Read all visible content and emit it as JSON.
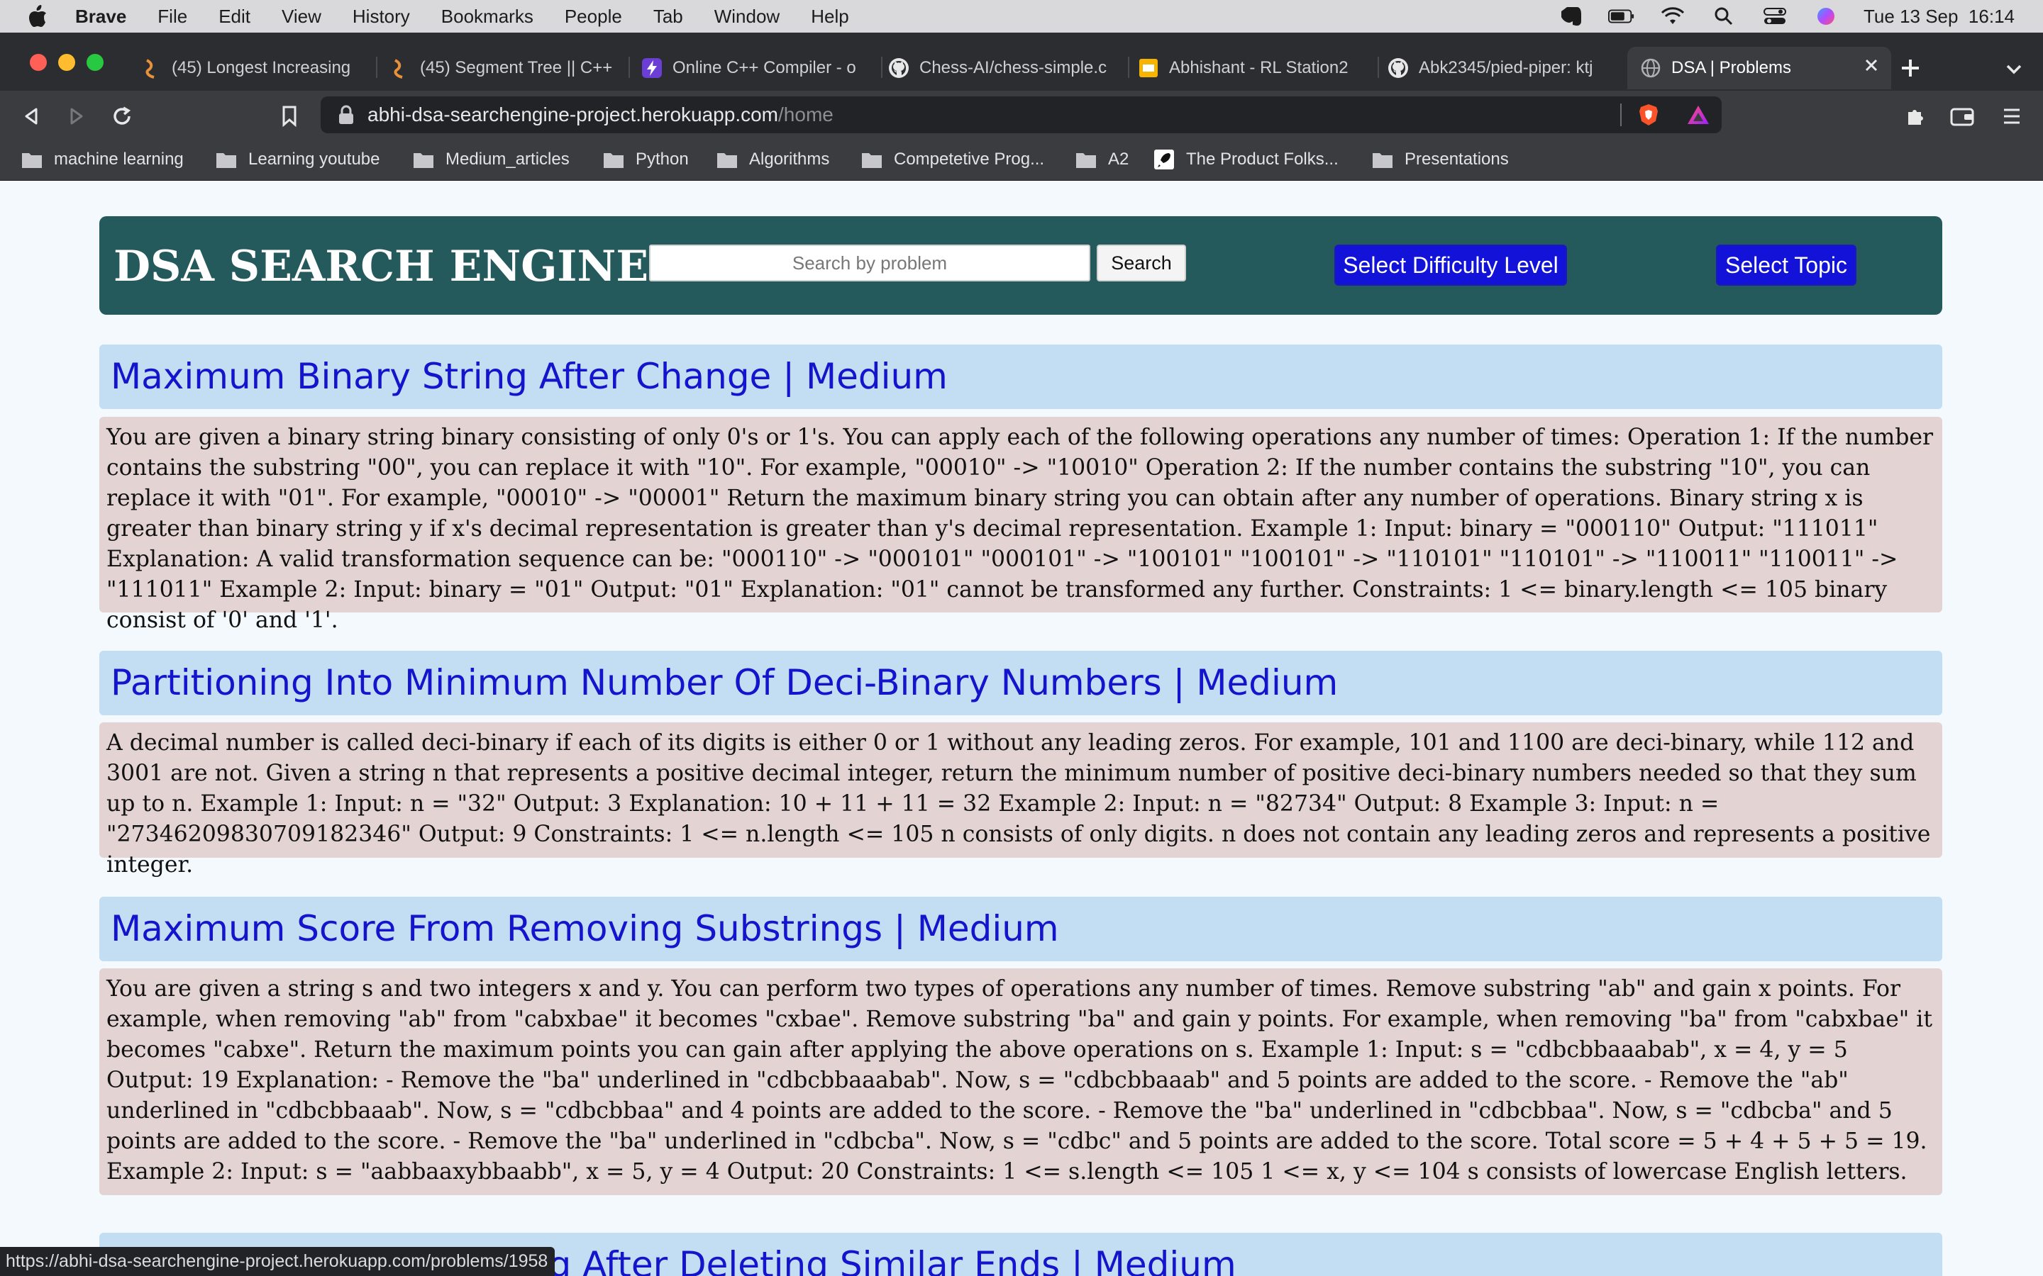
{
  "menubar": {
    "app_name": "Brave",
    "items": [
      "File",
      "Edit",
      "View",
      "History",
      "Bookmarks",
      "People",
      "Tab",
      "Window",
      "Help"
    ],
    "datetime": "Tue 13 Sep  16:14"
  },
  "tabs": [
    {
      "label": "(45) Longest Increasing",
      "icon": "codeforces-icon"
    },
    {
      "label": "(45) Segment Tree || C++",
      "icon": "codeforces-icon"
    },
    {
      "label": "Online C++ Compiler - o",
      "icon": "compiler-icon"
    },
    {
      "label": "Chess-AI/chess-simple.c",
      "icon": "github-icon"
    },
    {
      "label": "Abhishant - RL Station2",
      "icon": "slides-icon"
    },
    {
      "label": "Abk2345/pied-piper: ktj",
      "icon": "github-icon"
    },
    {
      "label": "DSA | Problems",
      "icon": "globe-icon",
      "active": true
    }
  ],
  "address": {
    "host": "abhi-dsa-searchengine-project.herokuapp.com",
    "path": "/home"
  },
  "bookmarks": [
    "machine learning",
    "Learning youtube",
    "Medium_articles",
    "Python",
    "Algorithms",
    "Competetive Prog...",
    "A2",
    "The Product Folks...",
    "Presentations"
  ],
  "header": {
    "title": "DSA SEARCH ENGINE",
    "search_placeholder": "Search by problem",
    "search_button": "Search",
    "difficulty_button": "Select Difficulty Level",
    "topic_button": "Select Topic"
  },
  "problems": [
    {
      "title": "Maximum Binary String After Change | Medium",
      "description": "You are given a binary string binary consisting of only 0's or 1's. You can apply each of the following operations any number of times: Operation 1: If the number contains the substring \"00\", you can replace it with \"10\". For example, \"00010\" -> \"10010\" Operation 2: If the number contains the substring \"10\", you can replace it with \"01\". For example, \"00010\" -> \"00001\" Return the maximum binary string you can obtain after any number of operations. Binary string x is greater than binary string y if x's decimal representation is greater than y's decimal representation.   Example 1: Input: binary = \"000110\" Output: \"111011\" Explanation: A valid transformation sequence can be: \"000110\" -> \"000101\" \"000101\" -> \"100101\" \"100101\" -> \"110101\" \"110101\" -> \"110011\" \"110011\" -> \"111011\" Example 2: Input: binary = \"01\" Output: \"01\" Explanation: \"01\" cannot be transformed any further.   Constraints: 1 <= binary.length <= 105 binary consist of '0' and '1'."
    },
    {
      "title": "Partitioning Into Minimum Number Of Deci-Binary Numbers | Medium",
      "description": "A decimal number is called deci-binary if each of its digits is either 0 or 1 without any leading zeros. For example, 101 and 1100 are deci-binary, while 112 and 3001 are not. Given a string n that represents a positive decimal integer, return the minimum number of positive deci-binary numbers needed so that they sum up to n.   Example 1: Input: n = \"32\" Output: 3 Explanation: 10 + 11 + 11 = 32 Example 2: Input: n = \"82734\" Output: 8 Example 3: Input: n = \"27346209830709182346\" Output: 9   Constraints: 1 <= n.length <= 105 n consists of only digits. n does not contain any leading zeros and represents a positive integer."
    },
    {
      "title": "Maximum Score From Removing Substrings | Medium",
      "description": "You are given a string s and two integers x and y. You can perform two types of operations any number of times. Remove substring \"ab\" and gain x points. For example, when removing \"ab\" from \"cabxbae\" it becomes \"cxbae\". Remove substring \"ba\" and gain y points. For example, when removing \"ba\" from \"cabxbae\" it becomes \"cabxe\". Return the maximum points you can gain after applying the above operations on s.   Example 1: Input: s = \"cdbcbbaaabab\", x = 4, y = 5 Output: 19 Explanation: - Remove the \"ba\" underlined in \"cdbcbbaaabab\". Now, s = \"cdbcbbaaab\" and 5 points are added to the score. - Remove the \"ab\" underlined in \"cdbcbbaaab\". Now, s = \"cdbcbbaa\" and 4 points are added to the score. - Remove the \"ba\" underlined in \"cdbcbbaa\". Now, s = \"cdbcba\" and 5 points are added to the score. - Remove the \"ba\" underlined in \"cdbcba\". Now, s = \"cdbc\" and 5 points are added to the score. Total score = 5 + 4 + 5 + 5 = 19. Example 2: Input: s = \"aabbaaxybbaabb\", x = 5, y = 4 Output: 20   Constraints: 1 <= s.length <= 105 1 <= x, y <= 104 s consists of lowercase English letters."
    },
    {
      "title": "Minimum Length of String After Deleting Similar Ends | Medium"
    }
  ],
  "status_url": "https://abhi-dsa-searchengine-project.herokuapp.com/problems/1958",
  "colors": {
    "header_bg": "#245a5c",
    "title_bar_bg": "#c3ddf3",
    "title_text": "#1414cc",
    "description_bg": "#e4d3d3",
    "button_blue": "#1212d8"
  }
}
